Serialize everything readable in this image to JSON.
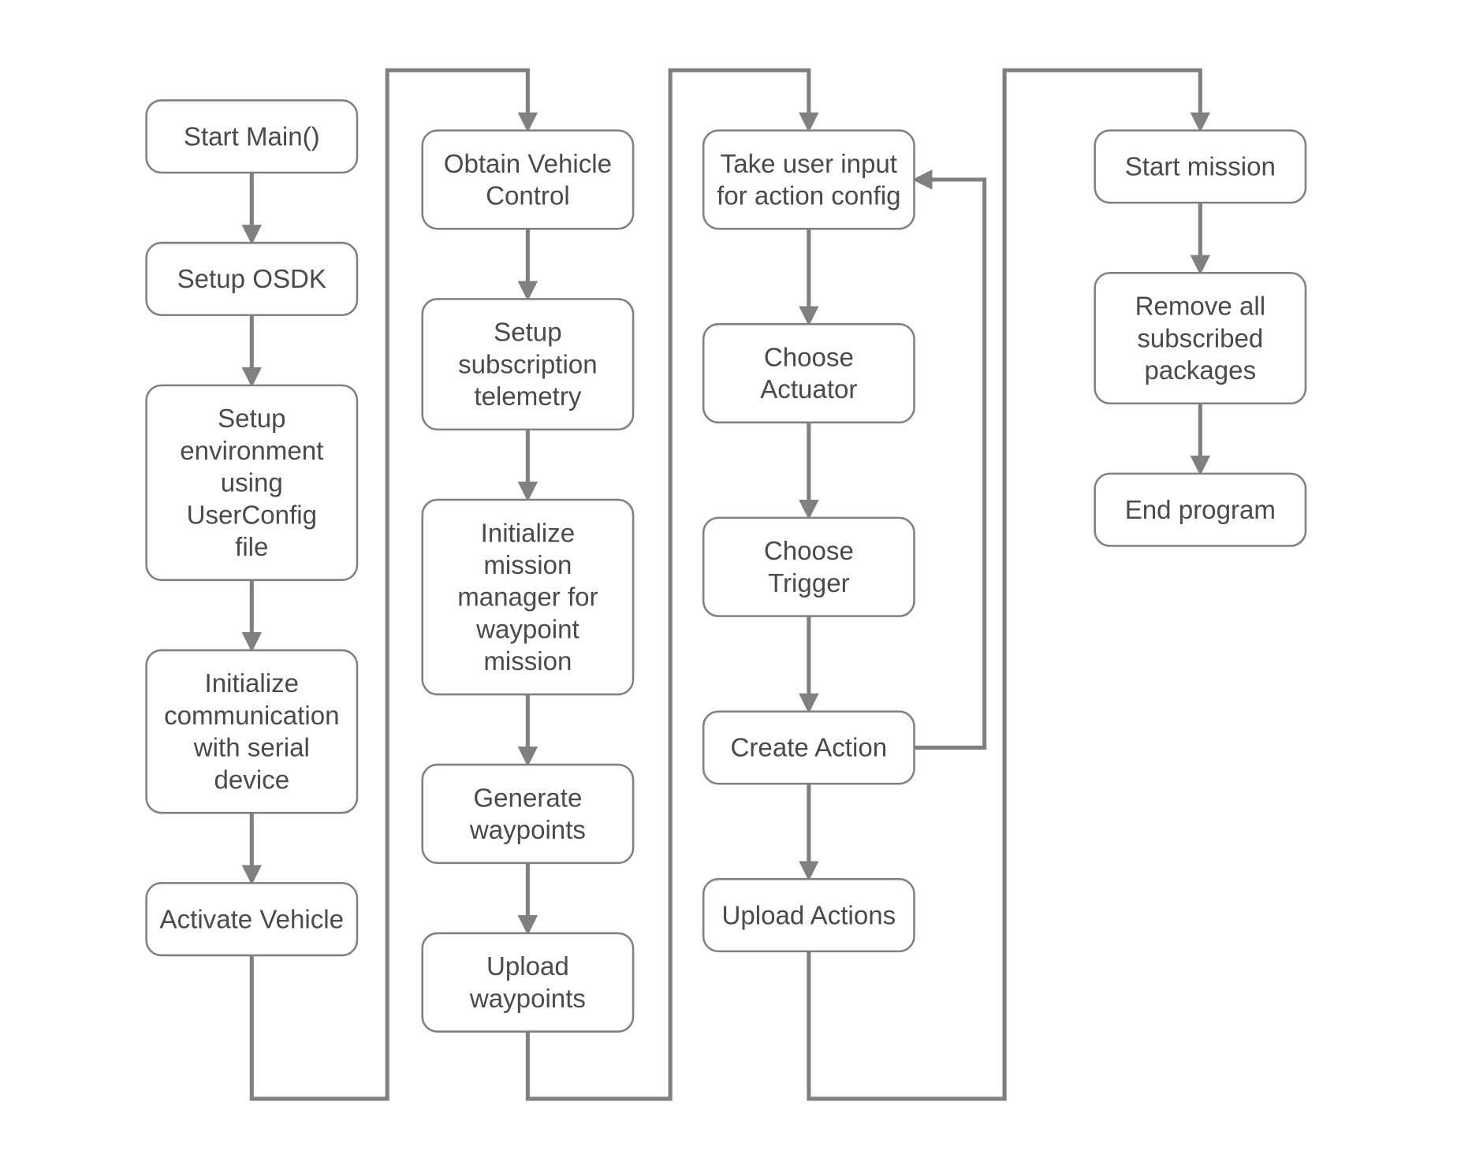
{
  "columns": [
    {
      "id": "col1",
      "nodes": [
        {
          "id": "n_start",
          "lines": [
            "Start Main()"
          ]
        },
        {
          "id": "n_osdk",
          "lines": [
            "Setup OSDK"
          ]
        },
        {
          "id": "n_env",
          "lines": [
            "Setup",
            "environment",
            "using",
            "UserConfig",
            "file"
          ]
        },
        {
          "id": "n_comm",
          "lines": [
            "Initialize",
            "communication",
            "with serial",
            "device"
          ]
        },
        {
          "id": "n_activate",
          "lines": [
            "Activate Vehicle"
          ]
        }
      ]
    },
    {
      "id": "col2",
      "nodes": [
        {
          "id": "n_obtain",
          "lines": [
            "Obtain Vehicle",
            "Control"
          ]
        },
        {
          "id": "n_sub",
          "lines": [
            "Setup",
            "subscription",
            "telemetry"
          ]
        },
        {
          "id": "n_initmm",
          "lines": [
            "Initialize",
            "mission",
            "manager for",
            "waypoint",
            "mission"
          ]
        },
        {
          "id": "n_genwp",
          "lines": [
            "Generate",
            "waypoints"
          ]
        },
        {
          "id": "n_upwp",
          "lines": [
            "Upload",
            "waypoints"
          ]
        }
      ]
    },
    {
      "id": "col3",
      "nodes": [
        {
          "id": "n_userin",
          "lines": [
            "Take user input",
            "for action config"
          ]
        },
        {
          "id": "n_actuator",
          "lines": [
            "Choose",
            "Actuator"
          ]
        },
        {
          "id": "n_trigger",
          "lines": [
            "Choose",
            "Trigger"
          ]
        },
        {
          "id": "n_create",
          "lines": [
            "Create Action"
          ]
        },
        {
          "id": "n_upact",
          "lines": [
            "Upload Actions"
          ]
        }
      ]
    },
    {
      "id": "col4",
      "nodes": [
        {
          "id": "n_startm",
          "lines": [
            "Start mission"
          ]
        },
        {
          "id": "n_remove",
          "lines": [
            "Remove all",
            "subscribed",
            "packages"
          ]
        },
        {
          "id": "n_end",
          "lines": [
            "End program"
          ]
        }
      ]
    }
  ],
  "chart_data": {
    "type": "flowchart",
    "edges": [
      [
        "n_start",
        "n_osdk"
      ],
      [
        "n_osdk",
        "n_env"
      ],
      [
        "n_env",
        "n_comm"
      ],
      [
        "n_comm",
        "n_activate"
      ],
      [
        "n_activate",
        "n_obtain"
      ],
      [
        "n_obtain",
        "n_sub"
      ],
      [
        "n_sub",
        "n_initmm"
      ],
      [
        "n_initmm",
        "n_genwp"
      ],
      [
        "n_genwp",
        "n_upwp"
      ],
      [
        "n_upwp",
        "n_userin"
      ],
      [
        "n_userin",
        "n_actuator"
      ],
      [
        "n_actuator",
        "n_trigger"
      ],
      [
        "n_trigger",
        "n_create"
      ],
      [
        "n_create",
        "n_upact"
      ],
      [
        "n_create",
        "n_userin",
        "loop"
      ],
      [
        "n_upact",
        "n_startm"
      ],
      [
        "n_startm",
        "n_remove"
      ],
      [
        "n_remove",
        "n_end"
      ]
    ]
  },
  "layout": {
    "colX": [
      140,
      415,
      695,
      1085
    ],
    "nodeW": 210,
    "lineH": 32,
    "padV": 20,
    "topY": [
      100,
      130,
      130,
      130
    ],
    "gapV": 70,
    "arrowLen": 55,
    "col3Gap": 95,
    "snakeTopY": 70,
    "snakeBotY": 1095,
    "loopRightX": 870,
    "snakeMidX": [
      275,
      557,
      890
    ]
  }
}
